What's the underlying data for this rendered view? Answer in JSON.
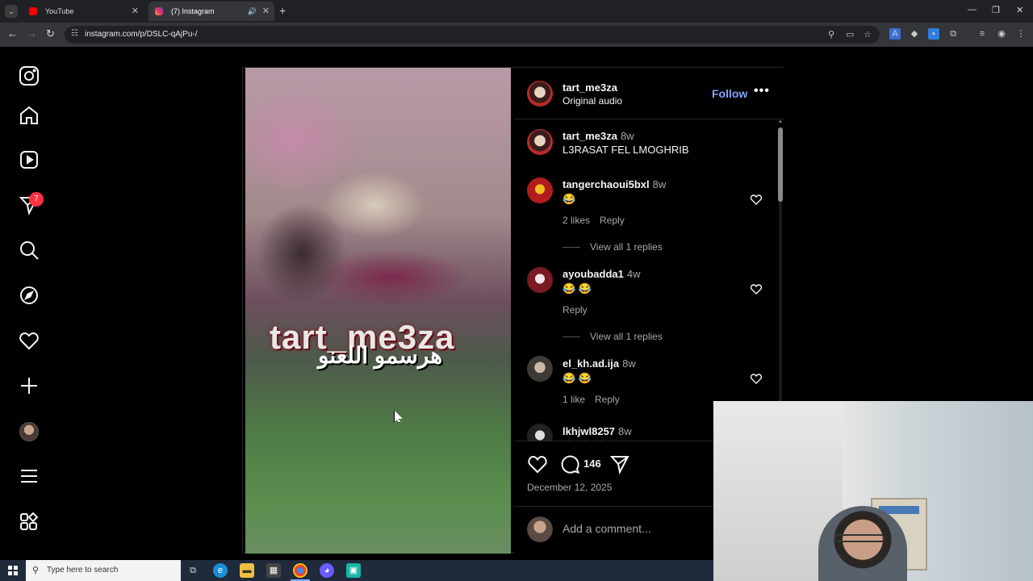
{
  "browser": {
    "tabs": [
      {
        "title": "YouTube",
        "active": false
      },
      {
        "title": "(7) Instagram",
        "active": true
      }
    ],
    "url": "instagram.com/p/DSLC-qAjPu-/"
  },
  "sidebar": {
    "notification_count": "7",
    "items": [
      "instagram-logo",
      "home",
      "reels",
      "messages",
      "search",
      "explore",
      "notifications",
      "create",
      "profile",
      "more",
      "also-from-meta"
    ]
  },
  "post": {
    "video_overlay_text": "tart_me3za",
    "video_overlay_arabic": "هرسمو اللعنو",
    "author": "tart_me3za",
    "audio": "Original audio",
    "follow_label": "Follow",
    "more_label": "•••",
    "caption": {
      "user": "tart_me3za",
      "time": "8w",
      "text": "L3RASAT FEL LMOGHRIB"
    },
    "comments": [
      {
        "user": "tangerchaoui5bxl",
        "time": "8w",
        "text": "😂",
        "likes": "2 likes",
        "reply": "Reply",
        "view_replies": "View all 1 replies"
      },
      {
        "user": "ayoubadda1",
        "time": "4w",
        "text": "😂 😂",
        "likes": "",
        "reply": "Reply",
        "view_replies": "View all 1 replies"
      },
      {
        "user": "el_kh.ad.ija",
        "time": "8w",
        "text": "😂 😂",
        "likes": "1 like",
        "reply": "Reply",
        "view_replies": ""
      },
      {
        "user": "lkhjwl8257",
        "time": "8w",
        "text": "😂 😂 😂",
        "likes": "",
        "reply": "",
        "view_replies": ""
      }
    ],
    "comment_count": "146",
    "date": "December 12, 2025",
    "add_comment_placeholder": "Add a comment..."
  },
  "taskbar": {
    "search_placeholder": "Type here to search"
  },
  "colors": {
    "follow": "#85a1ff",
    "badge": "#ff3040",
    "background": "#000000"
  }
}
